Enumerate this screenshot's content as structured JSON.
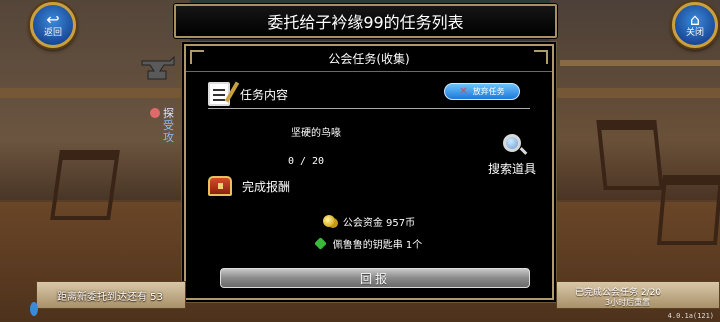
{
  "header": {
    "title": "委托给子衿缘99的任务列表",
    "back_label": "返回",
    "close_label": "关闭"
  },
  "side_text": {
    "line1": "探",
    "line2": "受",
    "line3": "攻"
  },
  "dialog": {
    "title": "公会任务(收集)",
    "task_section_label": "任务内容",
    "abandon_button_label": "放弃任务",
    "item_name": "坚硬的鸟喙",
    "item_progress": "0 / 20",
    "search_label": "搜索道具",
    "reward_section_label": "完成报酬",
    "rewards": [
      {
        "icon": "coin-icon",
        "text": "公会资金 957币"
      },
      {
        "icon": "key-icon",
        "text": "佩鲁鲁的钥匙串 1个"
      }
    ],
    "report_button_label": "回报"
  },
  "footer": {
    "next_request_text": "距离新委托到达还有 53",
    "completed_tasks_text": "已完成公会任务 2/20",
    "reset_text": "3小时后重置",
    "version": "4.0.1a(121)"
  },
  "colors": {
    "accent_gold": "#b09a6a",
    "button_blue": "#1e78d8",
    "panel_bg": "#000000"
  }
}
